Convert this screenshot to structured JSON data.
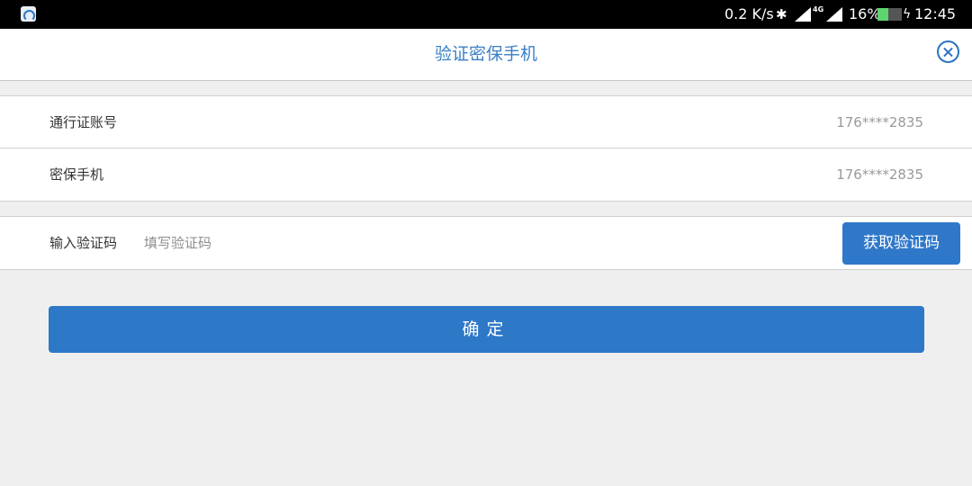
{
  "status_bar": {
    "speed": "0.2 K/s",
    "network_type": "4G",
    "battery_percent": "16%",
    "battery_level": 0.45,
    "time": "12:45",
    "icons": [
      "app-icon",
      "bluetooth-icon",
      "signal-icon",
      "signal-icon",
      "battery-icon",
      "charging-icon"
    ]
  },
  "header": {
    "title": "验证密保手机",
    "close_icon": "close-circle-icon",
    "accent_color": "#2d72c0"
  },
  "account_info": {
    "rows": [
      {
        "label": "通行证账号",
        "value": "176****2835"
      },
      {
        "label": "密保手机",
        "value": "176****2835"
      }
    ]
  },
  "verification": {
    "label": "输入验证码",
    "input_value": "",
    "placeholder": "填写验证码",
    "get_code_label": "获取验证码"
  },
  "confirm": {
    "label": "确定",
    "color": "#2e78c8"
  }
}
